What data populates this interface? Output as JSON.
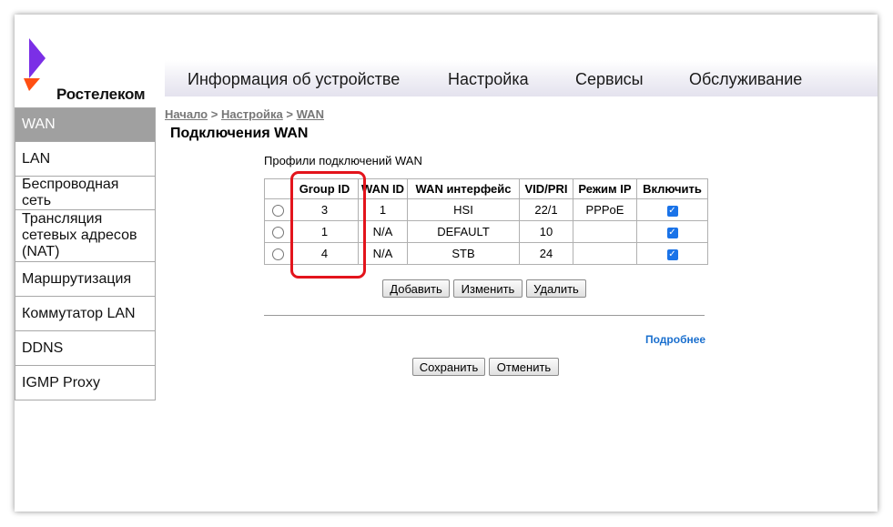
{
  "brand": {
    "name": "Ростелеком",
    "colors": {
      "purple": "#7b2fe6",
      "orange": "#ff4f12",
      "highlight": "#e3141c",
      "link": "#1a6fce"
    }
  },
  "topnav": {
    "items": [
      "Информация об устройстве",
      "Настройка",
      "Сервисы",
      "Обслуживание"
    ]
  },
  "sidebar": {
    "items": [
      {
        "label": "WAN",
        "active": true
      },
      {
        "label": "LAN"
      },
      {
        "label": "Беспроводная сеть"
      },
      {
        "label": "Трансляция сетевых адресов (NAT)"
      },
      {
        "label": "Маршрутизация"
      },
      {
        "label": "Коммутатор LAN"
      },
      {
        "label": "DDNS"
      },
      {
        "label": "IGMP Proxy"
      }
    ]
  },
  "breadcrumb": {
    "home": "Начало",
    "settings": "Настройка",
    "current": "WAN",
    "separator": ">"
  },
  "page_title": "Подключения WAN",
  "table": {
    "caption": "Профили подключений WAN",
    "headers": [
      "",
      "Group ID",
      "WAN ID",
      "WAN интерфейс",
      "VID/PRI",
      "Режим IP",
      "Включить"
    ],
    "rows": [
      {
        "group_id": "3",
        "wan_id": "1",
        "interface": "HSI",
        "vid_pri": "22/1",
        "ip_mode": "PPPoE",
        "enabled": true
      },
      {
        "group_id": "1",
        "wan_id": "N/A",
        "interface": "DEFAULT",
        "vid_pri": "10",
        "ip_mode": "",
        "enabled": true
      },
      {
        "group_id": "4",
        "wan_id": "N/A",
        "interface": "STB",
        "vid_pri": "24",
        "ip_mode": "",
        "enabled": true
      }
    ]
  },
  "buttons": {
    "add": "Добавить",
    "edit": "Изменить",
    "delete": "Удалить",
    "save": "Сохранить",
    "cancel": "Отменить"
  },
  "more_link": "Подробнее"
}
